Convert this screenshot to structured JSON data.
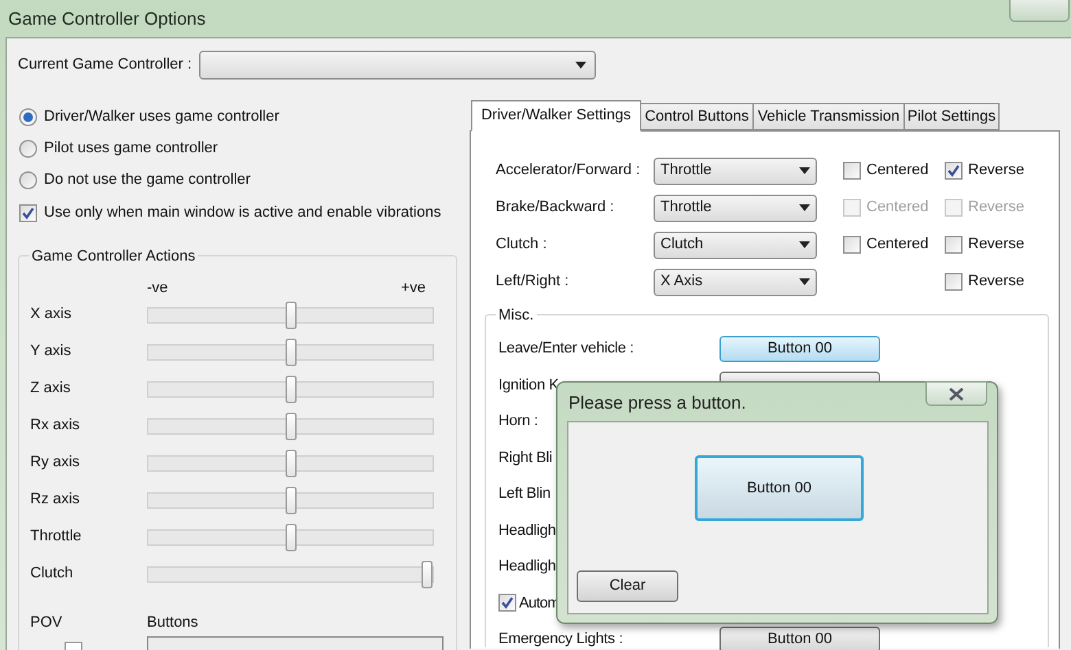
{
  "window": {
    "title": "Game Controller Options"
  },
  "controller": {
    "label": "Current Game Controller :"
  },
  "modes": [
    {
      "label": "Driver/Walker uses game controller",
      "selected": true
    },
    {
      "label": "Pilot uses game controller",
      "selected": false
    },
    {
      "label": "Do not use the game controller",
      "selected": false
    }
  ],
  "active_only": {
    "label": "Use only when main window is active and enable vibrations",
    "checked": true
  },
  "actions": {
    "title": "Game Controller Actions",
    "negative": "-ve",
    "positive": "+ve",
    "axes": [
      {
        "name": "X axis",
        "level": 0.5
      },
      {
        "name": "Y axis",
        "level": 0.5
      },
      {
        "name": "Z axis",
        "level": 0.5
      },
      {
        "name": "Rx axis",
        "level": 0.5
      },
      {
        "name": "Ry axis",
        "level": 0.5
      },
      {
        "name": "Rz axis",
        "level": 0.5
      },
      {
        "name": "Throttle",
        "level": 0.5
      },
      {
        "name": "Clutch",
        "level": 1
      }
    ],
    "pov_label": "POV",
    "buttons_label": "Buttons"
  },
  "tabs": [
    {
      "label": "Driver/Walker Settings",
      "selected": true
    },
    {
      "label": "Control Buttons",
      "selected": false
    },
    {
      "label": "Vehicle Transmission",
      "selected": false
    },
    {
      "label": "Pilot Settings",
      "selected": false
    }
  ],
  "axis_settings": [
    {
      "label": "Accelerator/Forward :",
      "value": "Throttle",
      "centered": {
        "label": "Centered",
        "checked": false,
        "disabled": false
      },
      "reverse": {
        "label": "Reverse",
        "checked": true,
        "disabled": false
      }
    },
    {
      "label": "Brake/Backward :",
      "value": "Throttle",
      "centered": {
        "label": "Centered",
        "checked": false,
        "disabled": true
      },
      "reverse": {
        "label": "Reverse",
        "checked": false,
        "disabled": true
      }
    },
    {
      "label": "Clutch :",
      "value": "Clutch",
      "centered": {
        "label": "Centered",
        "checked": false,
        "disabled": false
      },
      "reverse": {
        "label": "Reverse",
        "checked": false,
        "disabled": false
      }
    },
    {
      "label": "Left/Right :",
      "value": "X Axis",
      "reverse": {
        "label": "Reverse",
        "checked": false,
        "disabled": false
      }
    }
  ],
  "misc": {
    "title": "Misc.",
    "rows": [
      {
        "kind": "button",
        "label": "Leave/Enter vehicle :",
        "value": "Button 00",
        "focused": true
      },
      {
        "kind": "button",
        "label": "Ignition K",
        "focused": false
      },
      {
        "kind": "label",
        "label": "Horn :"
      },
      {
        "kind": "label",
        "label": "Right Bli"
      },
      {
        "kind": "label",
        "label": "Left Blin"
      },
      {
        "kind": "label",
        "label": "Headligh"
      },
      {
        "kind": "label",
        "label": "Headligh"
      },
      {
        "kind": "checkbox",
        "label": "Autom",
        "checked": true
      },
      {
        "kind": "button",
        "label": "Emergency Lights :",
        "value": "Button 00",
        "focused": false
      }
    ]
  },
  "dialog": {
    "title": "Please press a button.",
    "pressed": "Button 00",
    "clear": "Clear"
  }
}
